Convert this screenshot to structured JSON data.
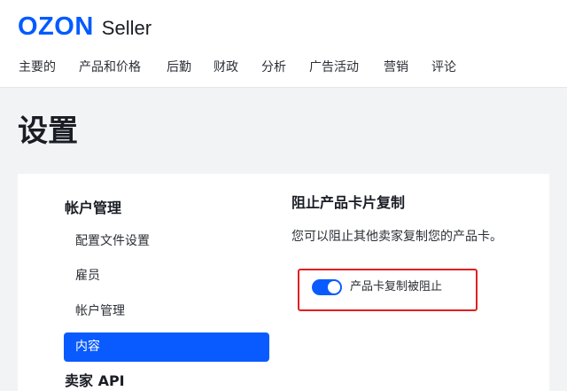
{
  "brand": {
    "logo_text": "OZON",
    "product_text": "Seller",
    "accent_color": "#005bff"
  },
  "nav": {
    "items": [
      {
        "label": "主要的"
      },
      {
        "label": "产品和价格"
      },
      {
        "label": "后勤"
      },
      {
        "label": "财政"
      },
      {
        "label": "分析"
      },
      {
        "label": "广告活动"
      },
      {
        "label": "营销"
      },
      {
        "label": "评论"
      }
    ]
  },
  "page": {
    "title": "设置"
  },
  "sidebar": {
    "section_title": "帐户管理",
    "items": [
      {
        "label": "配置文件设置",
        "active": false
      },
      {
        "label": "雇员",
        "active": false
      },
      {
        "label": "帐户管理",
        "active": false
      },
      {
        "label": "内容",
        "active": true
      }
    ],
    "section_title_2": "卖家 API"
  },
  "content": {
    "title": "阻止产品卡片复制",
    "description": "您可以阻止其他卖家复制您的产品卡。",
    "toggle": {
      "label": "产品卡复制被阻止",
      "checked": true,
      "icon": "toggle-switch-on"
    },
    "highlight_color": "#e02020"
  }
}
